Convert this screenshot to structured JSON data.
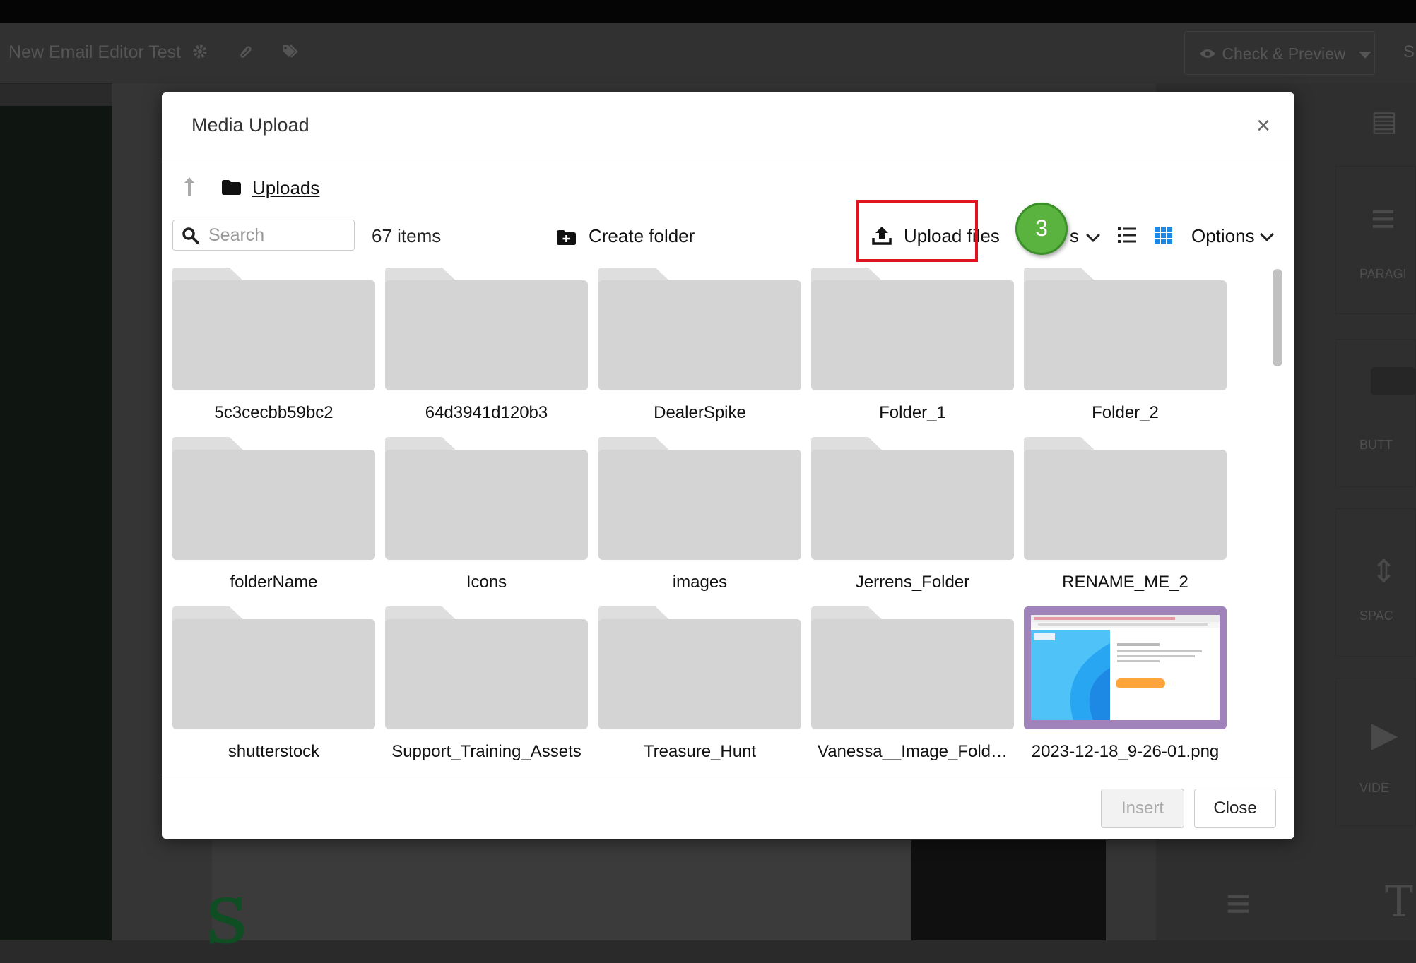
{
  "background": {
    "document_title": "New Email Editor Test",
    "header_icons": [
      "gear-icon",
      "paperclip-icon",
      "tags-icon"
    ],
    "check_preview_label": "Check & Preview",
    "header_partial": "S",
    "right_panel_labels": [
      "PARAGI",
      "BUTT",
      "SPAC",
      "VIDE"
    ]
  },
  "modal": {
    "title": "Media Upload",
    "close_glyph": "×",
    "breadcrumb": {
      "folder_label": "Uploads"
    },
    "toolbar": {
      "search_placeholder": "Search",
      "item_count": "67 items",
      "create_folder_label": "Create folder",
      "upload_files_label": "Upload files",
      "view_partial_label": "s",
      "options_label": "Options"
    },
    "step_badge": "3",
    "items": [
      {
        "name": "5c3cecbb59bc2",
        "kind": "folder"
      },
      {
        "name": "64d3941d120b3",
        "kind": "folder"
      },
      {
        "name": "DealerSpike",
        "kind": "folder"
      },
      {
        "name": "Folder_1",
        "kind": "folder"
      },
      {
        "name": "Folder_2",
        "kind": "folder"
      },
      {
        "name": "folderName",
        "kind": "folder"
      },
      {
        "name": "Icons",
        "kind": "folder"
      },
      {
        "name": "images",
        "kind": "folder"
      },
      {
        "name": "Jerrens_Folder",
        "kind": "folder"
      },
      {
        "name": "RENAME_ME_2",
        "kind": "folder"
      },
      {
        "name": "shutterstock",
        "kind": "folder"
      },
      {
        "name": "Support_Training_Assets",
        "kind": "folder"
      },
      {
        "name": "Treasure_Hunt",
        "kind": "folder"
      },
      {
        "name": "Vanessa__Image_Fold…",
        "kind": "folder"
      },
      {
        "name": "2023-12-18_9-26-01.png",
        "kind": "image"
      }
    ],
    "footer": {
      "insert_label": "Insert",
      "close_label": "Close"
    }
  },
  "colors": {
    "highlight_border": "#e0141e",
    "step_badge": "#59b33e",
    "folder_gray": "#d4d4d4",
    "grid_view_active": "#1e88e5",
    "thumbnail_frame": "#a183bb"
  }
}
